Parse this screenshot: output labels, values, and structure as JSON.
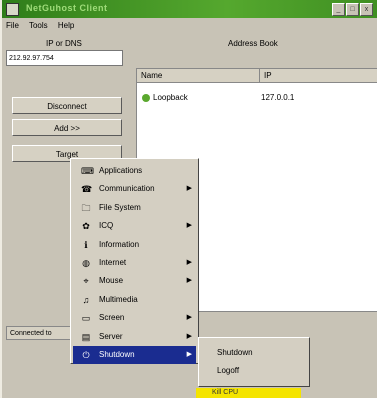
{
  "window": {
    "title": "NetGuhost Client",
    "min_label": "_",
    "max_label": "□",
    "close_label": "x"
  },
  "menubar": [
    "File",
    "Tools",
    "Help"
  ],
  "connection": {
    "ip_label": "IP or DNS",
    "ip_value": "212.92.97.754",
    "disconnect_label": "Disconnect",
    "add_label": "Add >>",
    "target_label": "Target"
  },
  "address_book": {
    "title": "Address Book",
    "columns": [
      "Name",
      "IP"
    ],
    "rows": [
      {
        "name": "Loopback",
        "ip": "127.0.0.1"
      }
    ]
  },
  "status": "Connected to",
  "context_menu": {
    "items": [
      {
        "label": "Applications",
        "icon": "applications-icon",
        "glyph": "⌨",
        "submenu": false
      },
      {
        "label": "Communication",
        "icon": "communication-icon",
        "glyph": "☎",
        "submenu": true
      },
      {
        "label": "File System",
        "icon": "file-system-icon",
        "glyph": "🗀",
        "submenu": false
      },
      {
        "label": "ICQ",
        "icon": "icq-icon",
        "glyph": "✿",
        "submenu": true
      },
      {
        "label": "Information",
        "icon": "information-icon",
        "glyph": "ℹ",
        "submenu": false
      },
      {
        "label": "Internet",
        "icon": "internet-icon",
        "glyph": "◍",
        "submenu": true
      },
      {
        "label": "Mouse",
        "icon": "mouse-icon",
        "glyph": "⌖",
        "submenu": true
      },
      {
        "label": "Multimedia",
        "icon": "multimedia-icon",
        "glyph": "♫",
        "submenu": false
      },
      {
        "label": "Screen",
        "icon": "screen-icon",
        "glyph": "▭",
        "submenu": true
      },
      {
        "label": "Server",
        "icon": "server-icon",
        "glyph": "▤",
        "submenu": true
      },
      {
        "label": "Shutdown",
        "icon": "shutdown-icon",
        "glyph": "⏻",
        "submenu": true,
        "selected": true
      }
    ],
    "arrow": "▶"
  },
  "shutdown_submenu": {
    "items": [
      "Shutdown",
      "Logoff"
    ],
    "highlighted": "Kill CPU"
  },
  "colors": {
    "background": "#e01a2a",
    "titlebar": "#3f8f22",
    "selection": "#1a2c90",
    "highlight": "#f4e400"
  }
}
